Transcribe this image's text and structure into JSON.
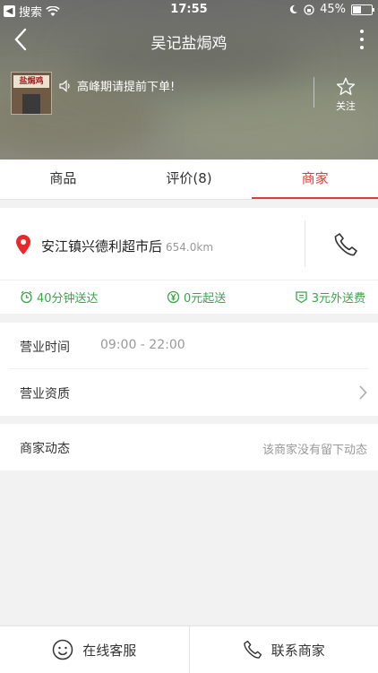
{
  "status_bar": {
    "back_app": "搜索",
    "time": "17:55",
    "battery": "45%"
  },
  "nav": {
    "title": "吴记盐焗鸡"
  },
  "shop": {
    "logo_sign": "盐焗鸡",
    "notice": "高峰期请提前下单!",
    "follow_label": "关注"
  },
  "tabs": [
    {
      "label": "商品",
      "active": false
    },
    {
      "label": "评价(8)",
      "active": false
    },
    {
      "label": "商家",
      "active": true
    }
  ],
  "address": {
    "text": "安江镇兴德利超市后",
    "distance": "654.0km"
  },
  "delivery": {
    "time": "40分钟送达",
    "min_order": "0元起送",
    "fee": "3元外送费"
  },
  "hours": {
    "label": "营业时间",
    "value": "09:00 - 22:00"
  },
  "license": {
    "label": "营业资质"
  },
  "dynamics": {
    "label": "商家动态",
    "empty_text": "该商家没有留下动态"
  },
  "bottom_bar": {
    "service": "在线客服",
    "contact": "联系商家"
  },
  "colors": {
    "accent": "#e23a3a",
    "green": "#3ba34a",
    "pin": "#e8282b"
  }
}
